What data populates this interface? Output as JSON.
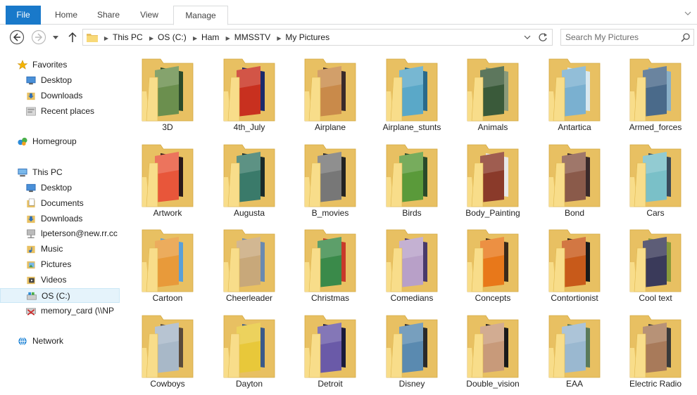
{
  "ribbon": {
    "tabs": [
      "File",
      "Home",
      "Share",
      "View",
      "Manage"
    ]
  },
  "address": {
    "crumbs": [
      "This PC",
      "OS (C:)",
      "Ham",
      "MMSSTV",
      "My Pictures"
    ]
  },
  "search": {
    "placeholder": "Search My Pictures"
  },
  "navpane": {
    "items": [
      {
        "label": "Favorites",
        "icon": "star-icon",
        "level": 0
      },
      {
        "label": "Desktop",
        "icon": "desktop-icon",
        "level": 1
      },
      {
        "label": "Downloads",
        "icon": "downloads-icon",
        "level": 1
      },
      {
        "label": "Recent places",
        "icon": "recent-places-icon",
        "level": 1
      },
      {
        "label": "Homegroup",
        "icon": "homegroup-icon",
        "level": 0
      },
      {
        "label": "This PC",
        "icon": "computer-icon",
        "level": 0
      },
      {
        "label": "Desktop",
        "icon": "desktop-icon",
        "level": 1
      },
      {
        "label": "Documents",
        "icon": "documents-icon",
        "level": 1
      },
      {
        "label": "Downloads",
        "icon": "downloads-icon",
        "level": 1
      },
      {
        "label": "lpeterson@new.rr.cc",
        "icon": "network-drive-icon",
        "level": 1
      },
      {
        "label": "Music",
        "icon": "music-icon",
        "level": 1
      },
      {
        "label": "Pictures",
        "icon": "pictures-icon",
        "level": 1
      },
      {
        "label": "Videos",
        "icon": "videos-icon",
        "level": 1
      },
      {
        "label": "OS (C:)",
        "icon": "drive-icon",
        "level": 1,
        "selected": true
      },
      {
        "label": "memory_card (\\\\NP",
        "icon": "disconnected-drive-icon",
        "level": 1
      },
      {
        "label": "Network",
        "icon": "network-icon",
        "level": 0
      }
    ]
  },
  "folders": [
    {
      "name": "3D",
      "colors": [
        "#6b8f4e",
        "#2b4a2a"
      ]
    },
    {
      "name": "4th_July",
      "colors": [
        "#c8301f",
        "#1c2a6b"
      ]
    },
    {
      "name": "Airplane",
      "colors": [
        "#c98a4a",
        "#3a2a2a"
      ]
    },
    {
      "name": "Airplane_stunts",
      "colors": [
        "#5aa8c8",
        "#2a6a8a"
      ]
    },
    {
      "name": "Animals",
      "colors": [
        "#3a5a3a",
        "#8a9a7a"
      ]
    },
    {
      "name": "Antartica",
      "colors": [
        "#7ab0d0",
        "#d8e8f0"
      ]
    },
    {
      "name": "Armed_forces",
      "colors": [
        "#4a6a8a",
        "#8ab0c8"
      ]
    },
    {
      "name": "Artwork",
      "colors": [
        "#e8563a",
        "#2a1a1a"
      ]
    },
    {
      "name": "Augusta",
      "colors": [
        "#3a7a6a",
        "#1a2a2a"
      ]
    },
    {
      "name": "B_movies",
      "colors": [
        "#777777",
        "#222222"
      ]
    },
    {
      "name": "Birds",
      "colors": [
        "#5a9a3a",
        "#2a4a2a"
      ]
    },
    {
      "name": "Body_Painting",
      "colors": [
        "#8a3a2a",
        "#e8e8e8"
      ]
    },
    {
      "name": "Bond",
      "colors": [
        "#8a5a4a",
        "#3a2a2a"
      ]
    },
    {
      "name": "Cars",
      "colors": [
        "#7ac0c8",
        "#3a4a5a"
      ]
    },
    {
      "name": "Cartoon",
      "colors": [
        "#e89a3a",
        "#5aa0d8"
      ]
    },
    {
      "name": "Cheerleader",
      "colors": [
        "#c8a87a",
        "#6a8ab0"
      ]
    },
    {
      "name": "Christmas",
      "colors": [
        "#3a8a4a",
        "#c83a2a"
      ]
    },
    {
      "name": "Comedians",
      "colors": [
        "#b8a0c8",
        "#4a3a6a"
      ]
    },
    {
      "name": "Concepts",
      "colors": [
        "#e8781a",
        "#3a2a1a"
      ]
    },
    {
      "name": "Contortionist",
      "colors": [
        "#c85a1a",
        "#1a1a1a"
      ]
    },
    {
      "name": "Cool text",
      "colors": [
        "#3a3a5a",
        "#8a9a3a"
      ]
    },
    {
      "name": "Cowboys",
      "colors": [
        "#a8b8c8",
        "#5a4a3a"
      ]
    },
    {
      "name": "Dayton",
      "colors": [
        "#e8c83a",
        "#3a5a8a"
      ]
    },
    {
      "name": "Detroit",
      "colors": [
        "#6a5aa8",
        "#1a1a3a"
      ]
    },
    {
      "name": "Disney",
      "colors": [
        "#5a8ab0",
        "#2a2a2a"
      ]
    },
    {
      "name": "Double_vision",
      "colors": [
        "#c89a7a",
        "#1a1a1a"
      ]
    },
    {
      "name": "EAA",
      "colors": [
        "#9ab8d0",
        "#5a7a5a"
      ]
    },
    {
      "name": "Electric Radio",
      "colors": [
        "#a87a5a",
        "#3a3a3a"
      ]
    }
  ],
  "colors": {
    "file_tab": "#1979ca",
    "folder_back": "#e8c062",
    "folder_front": "#f8dd8a",
    "selection": "#e5f3fb"
  }
}
